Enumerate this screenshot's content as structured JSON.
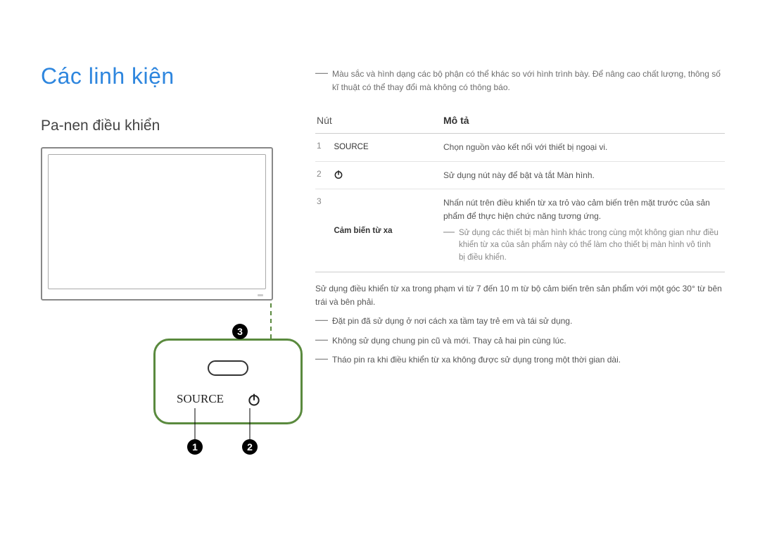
{
  "page": {
    "title": "Các linh kiện",
    "subtitle": "Pa-nen điều khiển"
  },
  "diagram": {
    "source_label": "SOURCE",
    "power_icon": "power-icon",
    "ir_sensor_icon": "ir-sensor",
    "callouts": {
      "c1": "1",
      "c2": "2",
      "c3": "3"
    }
  },
  "intro_note": "Màu sắc và hình dạng các bộ phận có thể khác so với hình trình bày. Để nâng cao chất lượng, thông số kĩ thuật có thể thay đổi mà không có thông báo.",
  "table": {
    "header": {
      "col1": "Nút",
      "col2": "Mô tả"
    },
    "rows": [
      {
        "num": "1",
        "label": "SOURCE",
        "label_bold": false,
        "has_icon": false,
        "desc": "Chọn nguồn vào kết nối với thiết bị ngoại vi."
      },
      {
        "num": "2",
        "label": "",
        "label_bold": false,
        "has_icon": true,
        "desc": "Sử dụng nút này để bật và tắt Màn hình."
      },
      {
        "num": "3",
        "label": "Cảm biến từ xa",
        "label_bold": true,
        "has_icon": false,
        "desc": "Nhấn nút trên điều khiển từ xa trỏ vào cảm biến trên mặt trước của sản phẩm để thực hiện chức năng tương ứng.",
        "note": "Sử dụng các thiết bị màn hình khác trong cùng một không gian như điều khiển từ xa của sản phẩm này có thể làm cho thiết bị màn hình vô tình bị điều khiển."
      }
    ]
  },
  "below": {
    "p1": "Sử dụng điều khiển từ xa trong phạm vi từ 7 đến 10 m từ bộ cảm biến trên sản phẩm với một góc 30° từ bên trái và bên phải.",
    "b1": "Đặt pin đã sử dụng ở nơi cách xa tầm tay trẻ em và tái sử dụng.",
    "b2": "Không sử dụng chung pin cũ và mới. Thay cả hai pin cùng lúc.",
    "b3": "Tháo pin ra khi điều khiển từ xa không được sử dụng trong một thời gian dài."
  }
}
